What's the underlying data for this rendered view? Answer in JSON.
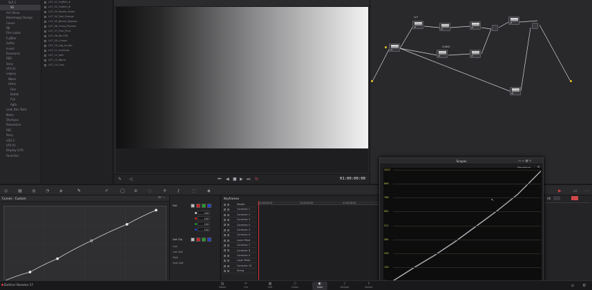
{
  "tree": {
    "items": [
      {
        "label": "SLP 2",
        "level": 1,
        "selected": false
      },
      {
        "label": "SS",
        "level": 2,
        "selected": true
      },
      {
        "label": "Arri Alexa",
        "level": 0
      },
      {
        "label": "Blackmagic Design",
        "level": 0
      },
      {
        "label": "Canon",
        "level": 0
      },
      {
        "label": "DJI",
        "level": 0
      },
      {
        "label": "Film Looks",
        "level": 0
      },
      {
        "label": "Fujifilm",
        "level": 0
      },
      {
        "label": "GoPro",
        "level": 0
      },
      {
        "label": "Invert",
        "level": 0
      },
      {
        "label": "Panasonic",
        "level": 0
      },
      {
        "label": "RED",
        "level": 0
      },
      {
        "label": "Sony",
        "level": 0
      },
      {
        "label": "VFX IO",
        "level": 0
      },
      {
        "label": "Legacy",
        "level": 0
      },
      {
        "label": "Nikon",
        "level": 1
      },
      {
        "label": "Other",
        "level": 1
      },
      {
        "label": "Film",
        "level": 2
      },
      {
        "label": "Kodak",
        "level": 2
      },
      {
        "label": "Fuji",
        "level": 2
      },
      {
        "label": "Agfa",
        "level": 2
      },
      {
        "label": "Look Dev Tools",
        "level": 0
      },
      {
        "label": "Mono",
        "level": 0
      },
      {
        "label": "Olympus",
        "level": 0
      },
      {
        "label": "Panavision",
        "level": 0
      },
      {
        "label": "REC",
        "level": 0
      },
      {
        "label": "Sony",
        "level": 0
      },
      {
        "label": "LOG-C",
        "level": 0
      },
      {
        "label": "VFX IO",
        "level": 0
      },
      {
        "label": "Display LUTs",
        "level": 0
      },
      {
        "label": "Favorites",
        "level": 0
      }
    ]
  },
  "lut_list": {
    "items": [
      "LUT_01_Fujifilm_A",
      "LUT_02_Fujifilm_B",
      "LUT_03_Kodak_Vision",
      "LUT_04_Teal_Orange",
      "LUT_05_Bleach_Bypass",
      "LUT_06_Cross_Process",
      "LUT_07_Film_Print",
      "LUT_08_Rec709",
      "LUT_09_Cineon",
      "LUT_10_Log_to_Rec",
      "LUT_11_Contrast",
      "LUT_12_Soft",
      "LUT_13_Warm",
      "LUT_14_Cool"
    ]
  },
  "viewer": {
    "timecode": "01:00:00:00",
    "transport": {
      "first": "⏮",
      "prev": "◀",
      "stop": "■",
      "play": "▶",
      "next": "⏭",
      "loop": "↻"
    }
  },
  "nodes": {
    "titles": {
      "lut": "LUT",
      "curve": "CURVE"
    }
  },
  "curves": {
    "title": "Curves - Custom",
    "control_points": [
      {
        "x": 0.0,
        "y": 0.0
      },
      {
        "x": 0.16,
        "y": 0.12
      },
      {
        "x": 0.33,
        "y": 0.3
      },
      {
        "x": 0.54,
        "y": 0.54
      },
      {
        "x": 0.76,
        "y": 0.76
      },
      {
        "x": 0.94,
        "y": 0.95
      }
    ]
  },
  "curve_channels": {
    "edit_label": "Edit",
    "values": [
      "100",
      "100",
      "100",
      "100"
    ],
    "soft_clip_label": "Soft Clip",
    "soft_clip_rows": [
      "Low",
      "Low Soft",
      "High",
      "High Soft"
    ]
  },
  "keyframes": {
    "title": "Keyframes",
    "timecodes": [
      "01:00:00:00",
      "01:00:04:00",
      "01:00:08:00"
    ],
    "tracks": [
      "Master",
      "Corrector 1",
      "Corrector 2",
      "Corrector 3",
      "Corrector 4",
      "Corrector 5",
      "Corrector 6",
      "Layer Mixer",
      "Corrector 7",
      "Corrector 8",
      "Corrector 9",
      "Layer Mixer",
      "Corrector 10",
      "Sizing"
    ]
  },
  "scopes": {
    "title": "Scopes",
    "mode": "Waveform",
    "y_labels": [
      "1023",
      "896",
      "768",
      "640",
      "512",
      "384",
      "256",
      "128",
      "0"
    ]
  },
  "right_panel": {
    "label": "All"
  },
  "bottom": {
    "app_name": "DaVinci Resolve 17",
    "pages": [
      "Media",
      "Cut",
      "Edit",
      "Fusion",
      "Color",
      "Fairlight",
      "Deliver"
    ]
  }
}
